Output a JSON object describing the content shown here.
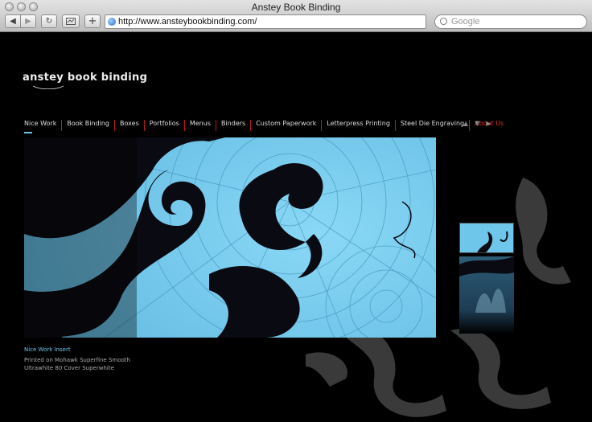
{
  "browser": {
    "window_title": "Anstey Book Binding",
    "url": "http://www.ansteybookbinding.com/",
    "search_placeholder": "Google",
    "back_label": "◀",
    "forward_label": "▶",
    "reload_label": "↻",
    "add_label": "+"
  },
  "site": {
    "logo_text": "anstey book binding",
    "nav": [
      {
        "label": "Nice Work"
      },
      {
        "label": "Book Binding"
      },
      {
        "label": "Boxes"
      },
      {
        "label": "Portfolios"
      },
      {
        "label": "Menus"
      },
      {
        "label": "Binders"
      },
      {
        "label": "Custom Paperwork"
      },
      {
        "label": "Letterpress Printing"
      },
      {
        "label": "Steel Die Engraving"
      },
      {
        "label": "About Us"
      }
    ],
    "arrows": [
      "▲",
      "▼",
      "▶"
    ],
    "caption": {
      "title": "Nice Work Insert",
      "line1": "Printed on Mohawk Superfine Smooth",
      "line2": "Ultrawhite 80 Cover Superwhite"
    }
  },
  "colors": {
    "accent_blue": "#6ec6ea",
    "accent_red": "#e02a23",
    "background": "#000000"
  }
}
